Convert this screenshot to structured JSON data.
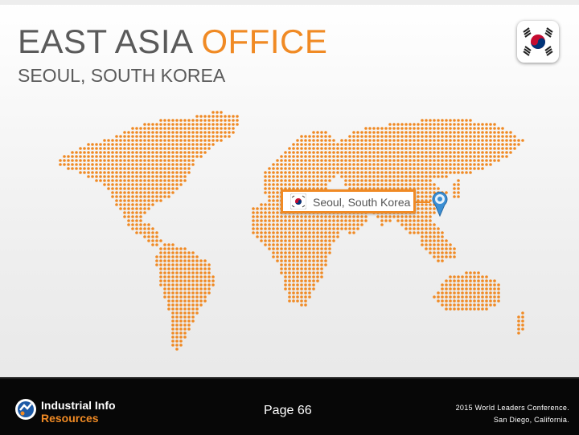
{
  "slide": {
    "title_main": "EAST ASIA",
    "title_accent": "OFFICE",
    "subtitle": "SEOUL, SOUTH KOREA"
  },
  "map": {
    "callout_label": "Seoul, South Korea",
    "dot_color": "#f08a24"
  },
  "icons": {
    "flag": "south-korea-flag-icon",
    "pin": "location-pin-icon",
    "logo": "industrial-info-logo-icon"
  },
  "footer": {
    "logo_line1": "Industrial Info",
    "logo_line2": "Resources",
    "page_label": "Page 66",
    "conference_line1": "2015 World Leaders Conference.",
    "conference_line2": "San Diego, California."
  },
  "colors": {
    "accent": "#f08a24",
    "title_gray": "#5a5a5a",
    "footer_bg": "#070707"
  }
}
